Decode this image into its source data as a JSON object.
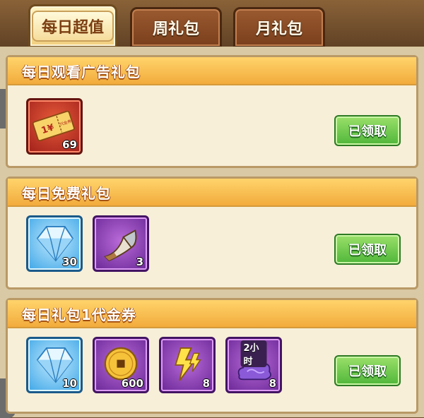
{
  "tabs": [
    {
      "label": "每日超值",
      "active": true
    },
    {
      "label": "周礼包",
      "active": false
    },
    {
      "label": "月礼包",
      "active": false
    }
  ],
  "sections": [
    {
      "title": "每日观看广告礼包",
      "items": [
        {
          "icon": "ticket-icon",
          "qty": "69",
          "frame": "red"
        }
      ],
      "claim_label": "已领取"
    },
    {
      "title": "每日免费礼包",
      "items": [
        {
          "icon": "diamond-icon",
          "qty": "30",
          "frame": "blue"
        },
        {
          "icon": "horn-icon",
          "qty": "3",
          "frame": "purple"
        }
      ],
      "claim_label": "已领取"
    },
    {
      "title": "每日礼包1代金券",
      "items": [
        {
          "icon": "diamond-icon",
          "qty": "10",
          "frame": "blue"
        },
        {
          "icon": "gold-coin-icon",
          "qty": "600",
          "frame": "purple"
        },
        {
          "icon": "lightning-icon",
          "qty": "8",
          "frame": "purple"
        },
        {
          "icon": "hourglass-cloud-icon",
          "qty": "8",
          "frame": "purple",
          "badge": "2小时"
        }
      ],
      "claim_label": "已领取"
    }
  ],
  "ticket_label": "1¥",
  "ticket_stamp": "代金券",
  "colors": {
    "header": "#f2ab3c",
    "claim_button": "#4fb63a",
    "panel": "#f7efd8"
  }
}
